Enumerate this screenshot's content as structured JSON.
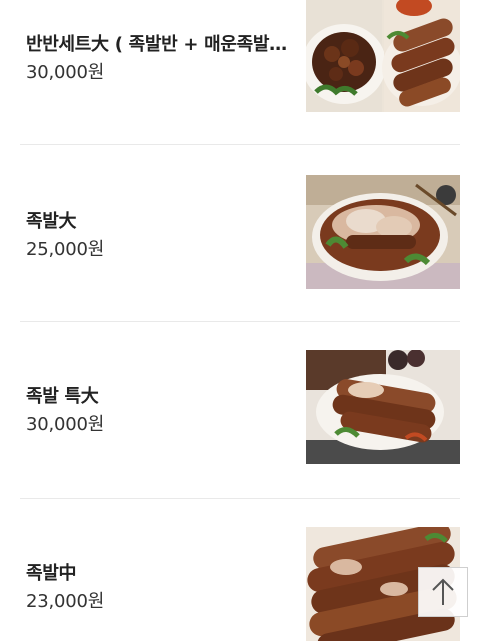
{
  "menu": {
    "items": [
      {
        "name": "반반세트大 ( 족발반 + 매운족발…",
        "price": "30,000원",
        "image": "half-half-set-photo"
      },
      {
        "name": "족발大",
        "price": "25,000원",
        "image": "jokbal-large-photo"
      },
      {
        "name": "족발 특大",
        "price": "30,000원",
        "image": "jokbal-xl-photo"
      },
      {
        "name": "족발中",
        "price": "23,000원",
        "image": "jokbal-medium-photo"
      }
    ]
  },
  "scroll_top": {
    "icon": "arrow-up-icon"
  },
  "colors": {
    "divider": "#e9e9e9",
    "text": "#222222",
    "meat": "#7a3a1e",
    "plate": "#f1ece4"
  }
}
